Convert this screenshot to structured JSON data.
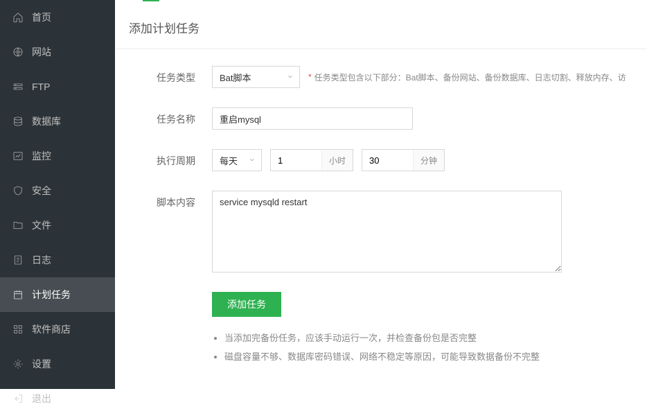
{
  "sidebar": {
    "items": [
      {
        "label": "首页",
        "icon": "home"
      },
      {
        "label": "网站",
        "icon": "globe"
      },
      {
        "label": "FTP",
        "icon": "ftp"
      },
      {
        "label": "数据库",
        "icon": "database"
      },
      {
        "label": "监控",
        "icon": "monitor"
      },
      {
        "label": "安全",
        "icon": "shield"
      },
      {
        "label": "文件",
        "icon": "folder"
      },
      {
        "label": "日志",
        "icon": "log"
      },
      {
        "label": "计划任务",
        "icon": "calendar",
        "active": true
      },
      {
        "label": "软件商店",
        "icon": "apps"
      },
      {
        "label": "设置",
        "icon": "gear"
      },
      {
        "label": "退出",
        "icon": "exit"
      }
    ]
  },
  "page": {
    "title": "添加计划任务"
  },
  "form": {
    "task_type": {
      "label": "任务类型",
      "value": "Bat脚本",
      "help": "任务类型包含以下部分：Bat脚本、备份网站、备份数据库、日志切割、释放内存、访"
    },
    "task_name": {
      "label": "任务名称",
      "value": "重启mysql"
    },
    "cycle": {
      "label": "执行周期",
      "period": "每天",
      "hour": "1",
      "hour_unit": "小时",
      "minute": "30",
      "minute_unit": "分钟"
    },
    "script": {
      "label": "脚本内容",
      "value": "service mysqld restart"
    },
    "submit": "添加任务"
  },
  "notes": [
    "当添加完备份任务，应该手动运行一次，并检查备份包是否完整",
    "磁盘容量不够、数据库密码错误、网络不稳定等原因，可能导致数据备份不完整"
  ]
}
